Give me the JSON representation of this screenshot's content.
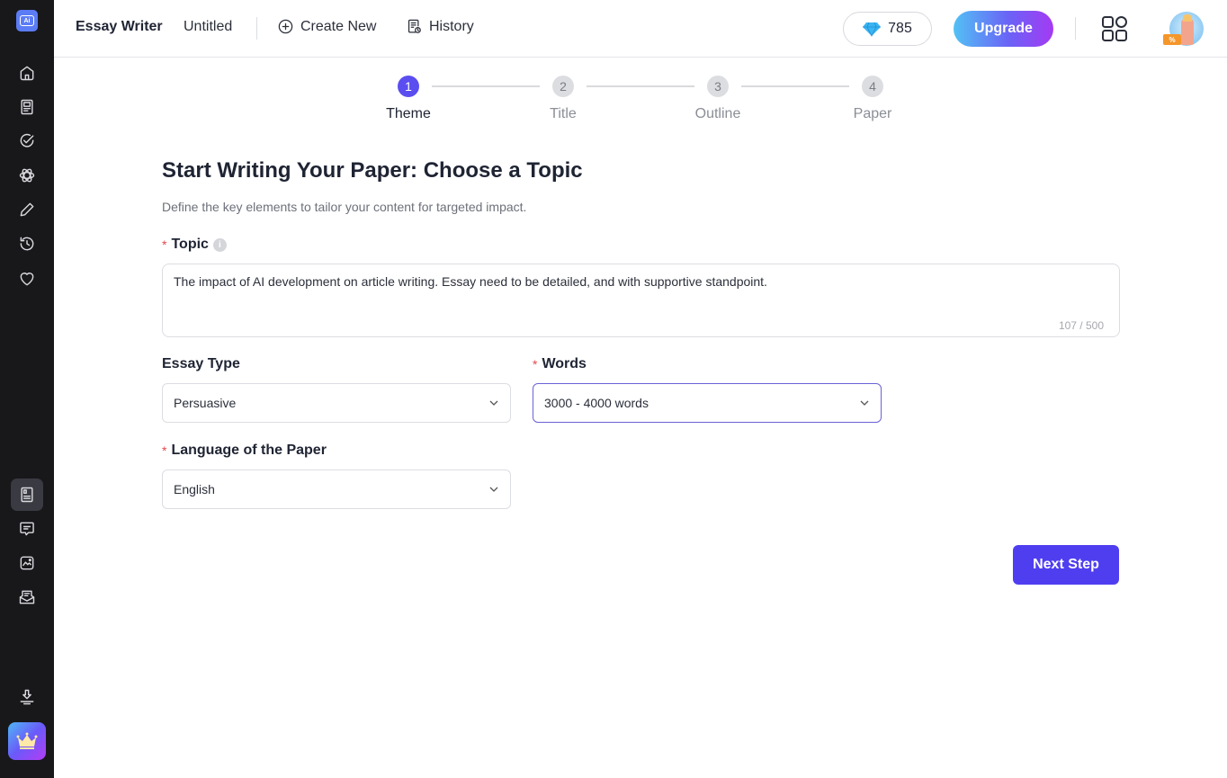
{
  "sidebar": {
    "logo_text": "Ai",
    "top_items": [
      {
        "name": "home",
        "icon": "home-icon"
      },
      {
        "name": "document",
        "icon": "document-icon"
      },
      {
        "name": "check",
        "icon": "check-circle-icon"
      },
      {
        "name": "atom",
        "icon": "atom-icon"
      },
      {
        "name": "pencil",
        "icon": "pencil-icon"
      },
      {
        "name": "history",
        "icon": "history-icon"
      },
      {
        "name": "favorites",
        "icon": "heart-icon"
      }
    ],
    "bottom_items": [
      {
        "name": "essay-writer",
        "icon": "essay-icon",
        "active": true
      },
      {
        "name": "chat",
        "icon": "chat-icon"
      },
      {
        "name": "image",
        "icon": "image-icon"
      },
      {
        "name": "inbox",
        "icon": "inbox-icon"
      }
    ],
    "download_icon": "download-icon",
    "premium_icon": "crown-icon"
  },
  "topbar": {
    "app_title": "Essay Writer",
    "doc_name": "Untitled",
    "create_new_label": "Create New",
    "history_label": "History",
    "credits": "785",
    "upgrade_label": "Upgrade",
    "promo_badge": "%"
  },
  "stepper": {
    "steps": [
      {
        "number": "1",
        "label": "Theme",
        "active": true
      },
      {
        "number": "2",
        "label": "Title",
        "active": false
      },
      {
        "number": "3",
        "label": "Outline",
        "active": false
      },
      {
        "number": "4",
        "label": "Paper",
        "active": false
      }
    ]
  },
  "form": {
    "title": "Start Writing Your Paper: Choose a Topic",
    "subtitle": "Define the key elements to tailor your content for targeted impact.",
    "required_mark": "*",
    "topic": {
      "label": "Topic",
      "info_glyph": "i",
      "value": "The impact of AI development on article writing. Essay need to be detailed, and with supportive standpoint.",
      "counter": "107 / 500"
    },
    "essay_type": {
      "label": "Essay Type",
      "value": "Persuasive"
    },
    "words": {
      "label": "Words",
      "value": "3000 - 4000 words"
    },
    "language": {
      "label": "Language of the Paper",
      "value": "English"
    },
    "next_label": "Next Step"
  },
  "colors": {
    "accent": "#4f3ef0",
    "step_active": "#5b4ef0",
    "sidebar_bg": "#18181b",
    "required": "#e5484d"
  }
}
